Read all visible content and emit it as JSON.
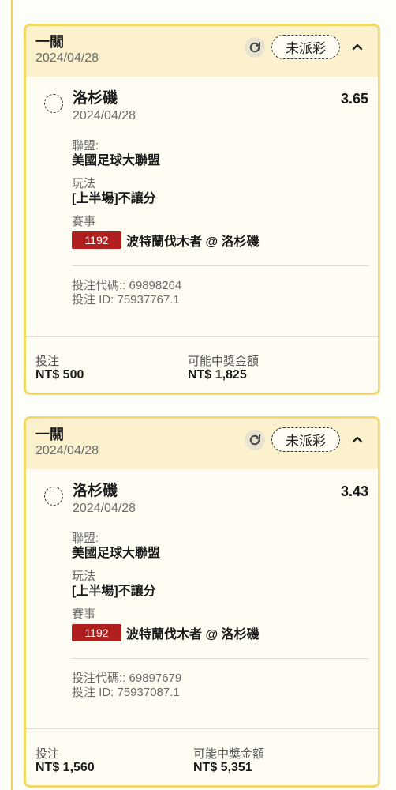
{
  "bets": [
    {
      "header_title": "一關",
      "header_date": "2024/04/28",
      "status": "未派彩",
      "selection": "洛杉磯",
      "selection_date": "2024/04/28",
      "odds": "3.65",
      "league_label": "聯盟:",
      "league": "美國足球大聯盟",
      "market_label": "玩法",
      "market": "[上半場]不讓分",
      "event_label": "賽事",
      "event_id": "1192",
      "event_name": "波特蘭伐木者 @ 洛杉磯",
      "code_line": "投注代碼:: 69898264",
      "id_line": "投注 ID: 75937767.1",
      "stake_label": "投注",
      "stake": "NT$ 500",
      "payout_label": "可能中獎金額",
      "payout": "NT$ 1,825"
    },
    {
      "header_title": "一關",
      "header_date": "2024/04/28",
      "status": "未派彩",
      "selection": "洛杉磯",
      "selection_date": "2024/04/28",
      "odds": "3.43",
      "league_label": "聯盟:",
      "league": "美國足球大聯盟",
      "market_label": "玩法",
      "market": "[上半場]不讓分",
      "event_label": "賽事",
      "event_id": "1192",
      "event_name": "波特蘭伐木者 @ 洛杉磯",
      "code_line": "投注代碼:: 69897679",
      "id_line": "投注 ID: 75937087.1",
      "stake_label": "投注",
      "stake": "NT$ 1,560",
      "payout_label": "可能中獎金額",
      "payout": "NT$ 5,351"
    }
  ],
  "icons": {
    "refresh": "refresh-icon",
    "collapse": "chevron-up-icon",
    "radio": "radio-unselected-icon"
  },
  "colors": {
    "accent": "#f3d86a",
    "header_bg": "#fbf1cc",
    "event_badge": "#b0201e"
  }
}
